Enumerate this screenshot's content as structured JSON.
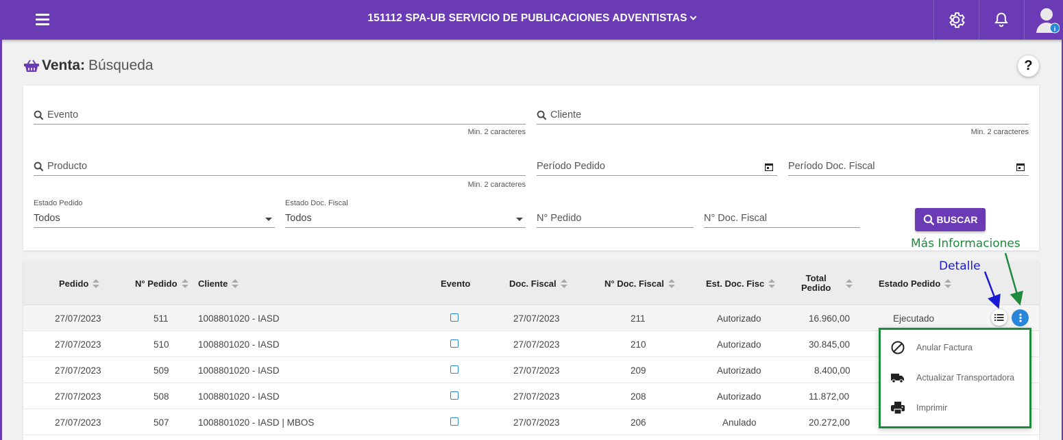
{
  "topbar": {
    "organization": "151112 SPA-UB SERVICIO DE PUBLICACIONES ADVENTISTAS",
    "icons": [
      "menu-icon",
      "gear-icon",
      "bell-icon",
      "user-avatar-icon"
    ],
    "accent_color": "#6a3bb5"
  },
  "page": {
    "title_bold": "Venta:",
    "title_rest": "Búsqueda",
    "help_label": "?"
  },
  "filters": {
    "evento": {
      "placeholder": "Evento",
      "hint": "Min. 2 caracteres"
    },
    "cliente": {
      "placeholder": "Cliente",
      "hint": "Min. 2 caracteres"
    },
    "producto": {
      "placeholder": "Producto",
      "hint": "Min. 2 caracteres"
    },
    "periodo_pedido": {
      "placeholder": "Período Pedido"
    },
    "periodo_doc_fiscal": {
      "placeholder": "Período Doc. Fiscal"
    },
    "estado_pedido": {
      "label": "Estado Pedido",
      "value": "Todos"
    },
    "estado_doc_fiscal": {
      "label": "Estado Doc. Fiscal",
      "value": "Todos"
    },
    "n_pedido": {
      "placeholder": "N° Pedido"
    },
    "n_doc_fiscal": {
      "placeholder": "N° Doc. Fiscal"
    },
    "search_button": "BUSCAR"
  },
  "table": {
    "headers": {
      "pedido": "Pedido",
      "n_pedido": "N° Pedido",
      "cliente": "Cliente",
      "evento": "Evento",
      "doc_fiscal": "Doc. Fiscal",
      "n_doc_fiscal": "N° Doc. Fiscal",
      "est_doc_fisc": "Est. Doc. Fisc",
      "total_line1": "Total",
      "total_line2": "Pedido",
      "estado_pedido": "Estado Pedido"
    },
    "rows": [
      {
        "pedido": "27/07/2023",
        "n_pedido": "511",
        "cliente": "1008801020 - IASD",
        "doc_fiscal": "27/07/2023",
        "n_doc_fiscal": "211",
        "est_doc_fisc": "Autorizado",
        "total": "16.960,00",
        "estado": "Ejecutado"
      },
      {
        "pedido": "27/07/2023",
        "n_pedido": "510",
        "cliente": "1008801020 - IASD",
        "doc_fiscal": "27/07/2023",
        "n_doc_fiscal": "210",
        "est_doc_fisc": "Autorizado",
        "total": "30.845,00",
        "estado": ""
      },
      {
        "pedido": "27/07/2023",
        "n_pedido": "509",
        "cliente": "1008801020 - IASD",
        "doc_fiscal": "27/07/2023",
        "n_doc_fiscal": "209",
        "est_doc_fisc": "Autorizado",
        "total": "8.400,00",
        "estado": ""
      },
      {
        "pedido": "27/07/2023",
        "n_pedido": "508",
        "cliente": "1008801020 - IASD",
        "doc_fiscal": "27/07/2023",
        "n_doc_fiscal": "208",
        "est_doc_fisc": "Autorizado",
        "total": "11.872,00",
        "estado": ""
      },
      {
        "pedido": "27/07/2023",
        "n_pedido": "507",
        "cliente": "1008801020 - IASD | MBOS",
        "doc_fiscal": "27/07/2023",
        "n_doc_fiscal": "206",
        "est_doc_fisc": "Anulado",
        "total": "20.272,00",
        "estado": ""
      }
    ]
  },
  "row_menu": {
    "items": [
      {
        "label": "Anular Factura",
        "icon": "block-icon"
      },
      {
        "label": "Actualizar Transportadora",
        "icon": "truck-icon"
      },
      {
        "label": "Imprimir",
        "icon": "printer-icon"
      }
    ]
  },
  "annotations": {
    "mas_informaciones": "Más Informaciones",
    "detalle": "Detalle",
    "green": "#1e8a3c",
    "blue": "#1a1ad0"
  }
}
